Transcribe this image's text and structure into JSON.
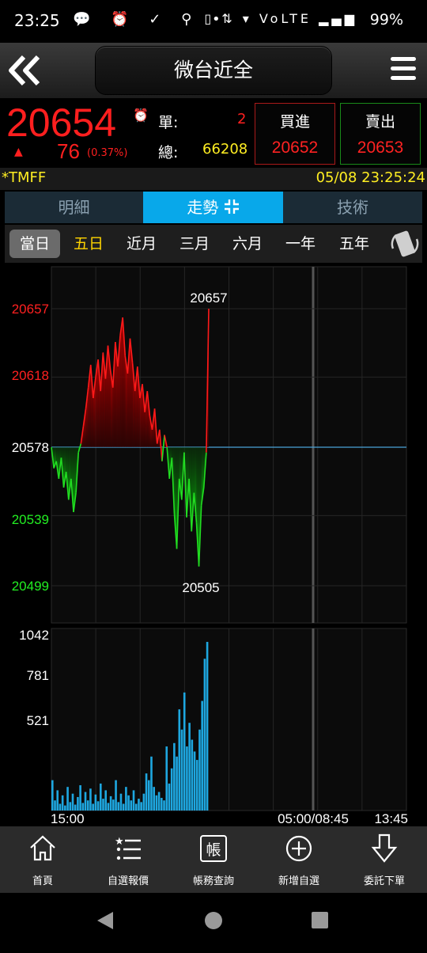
{
  "status_bar": {
    "time": "23:25",
    "left_icons": "💬 ⏰ ✓ ⚲ •",
    "right_icons": "▯ ⇅ ▾ VoLTE ▂▄▆",
    "battery": "99%"
  },
  "header": {
    "title": "微台近全"
  },
  "quote": {
    "price": "20654",
    "change": "76",
    "change_pct": "(0.37%)",
    "unit_label": "單:",
    "unit_value": "2",
    "total_label": "總:",
    "total_value": "66208",
    "buy_label": "買進",
    "buy_value": "20652",
    "sell_label": "賣出",
    "sell_value": "20653"
  },
  "info": {
    "symbol": "*TMFF",
    "datetime": "05/08 23:25:24"
  },
  "tabs": [
    {
      "label": "明細"
    },
    {
      "label": "走勢"
    },
    {
      "label": "技術"
    }
  ],
  "periods": [
    {
      "label": "當日"
    },
    {
      "label": "五日"
    },
    {
      "label": "近月"
    },
    {
      "label": "三月"
    },
    {
      "label": "六月"
    },
    {
      "label": "一年"
    },
    {
      "label": "五年"
    }
  ],
  "chart_data": {
    "type": "line",
    "price_ticks": [
      "20657",
      "20618",
      "20578",
      "20539",
      "20499"
    ],
    "reference_price": 20578,
    "high_label": "20657",
    "low_label": "20505",
    "volume_ticks": [
      "1042",
      "781",
      "521"
    ],
    "x_labels": [
      "15:00",
      "05:00/08:45",
      "13:45"
    ],
    "colors": {
      "up": "#ff1a1a",
      "down": "#22dd22",
      "volume": "#1ea7e0",
      "reference": "#4aa4d8"
    },
    "price_series": [
      20578,
      20566,
      20570,
      20560,
      20572,
      20555,
      20564,
      20548,
      20560,
      20541,
      20552,
      20575,
      20580,
      20590,
      20600,
      20612,
      20625,
      20606,
      20618,
      20628,
      20610,
      20632,
      20617,
      20636,
      20622,
      20612,
      20638,
      20624,
      20642,
      20652,
      20630,
      20620,
      20640,
      20626,
      20610,
      20624,
      20606,
      20614,
      20598,
      20610,
      20596,
      20588,
      20600,
      20580,
      20588,
      20570,
      20585,
      20578,
      20560,
      20572,
      20540,
      20520,
      20560,
      20548,
      20575,
      20538,
      20560,
      20530,
      20552,
      20535,
      20510,
      20545,
      20555,
      20575,
      20657
    ],
    "volume_series": [
      180,
      60,
      120,
      40,
      90,
      30,
      140,
      50,
      100,
      35,
      80,
      150,
      45,
      110,
      60,
      130,
      40,
      95,
      55,
      160,
      70,
      120,
      45,
      85,
      65,
      180,
      50,
      100,
      40,
      140,
      90,
      60,
      120,
      40,
      70,
      50,
      100,
      220,
      180,
      320,
      140,
      90,
      110,
      75,
      60,
      380,
      160,
      250,
      400,
      320,
      600,
      480,
      700,
      380,
      520,
      420,
      350,
      300,
      480,
      650,
      900,
      1000
    ]
  },
  "nav": [
    {
      "label": "首頁",
      "icon": "home-icon"
    },
    {
      "label": "自選報價",
      "icon": "watchlist-icon"
    },
    {
      "label": "帳務查詢",
      "icon": "account-icon",
      "glyph": "帳"
    },
    {
      "label": "新增自選",
      "icon": "add-icon"
    },
    {
      "label": "委託下單",
      "icon": "order-icon"
    }
  ]
}
